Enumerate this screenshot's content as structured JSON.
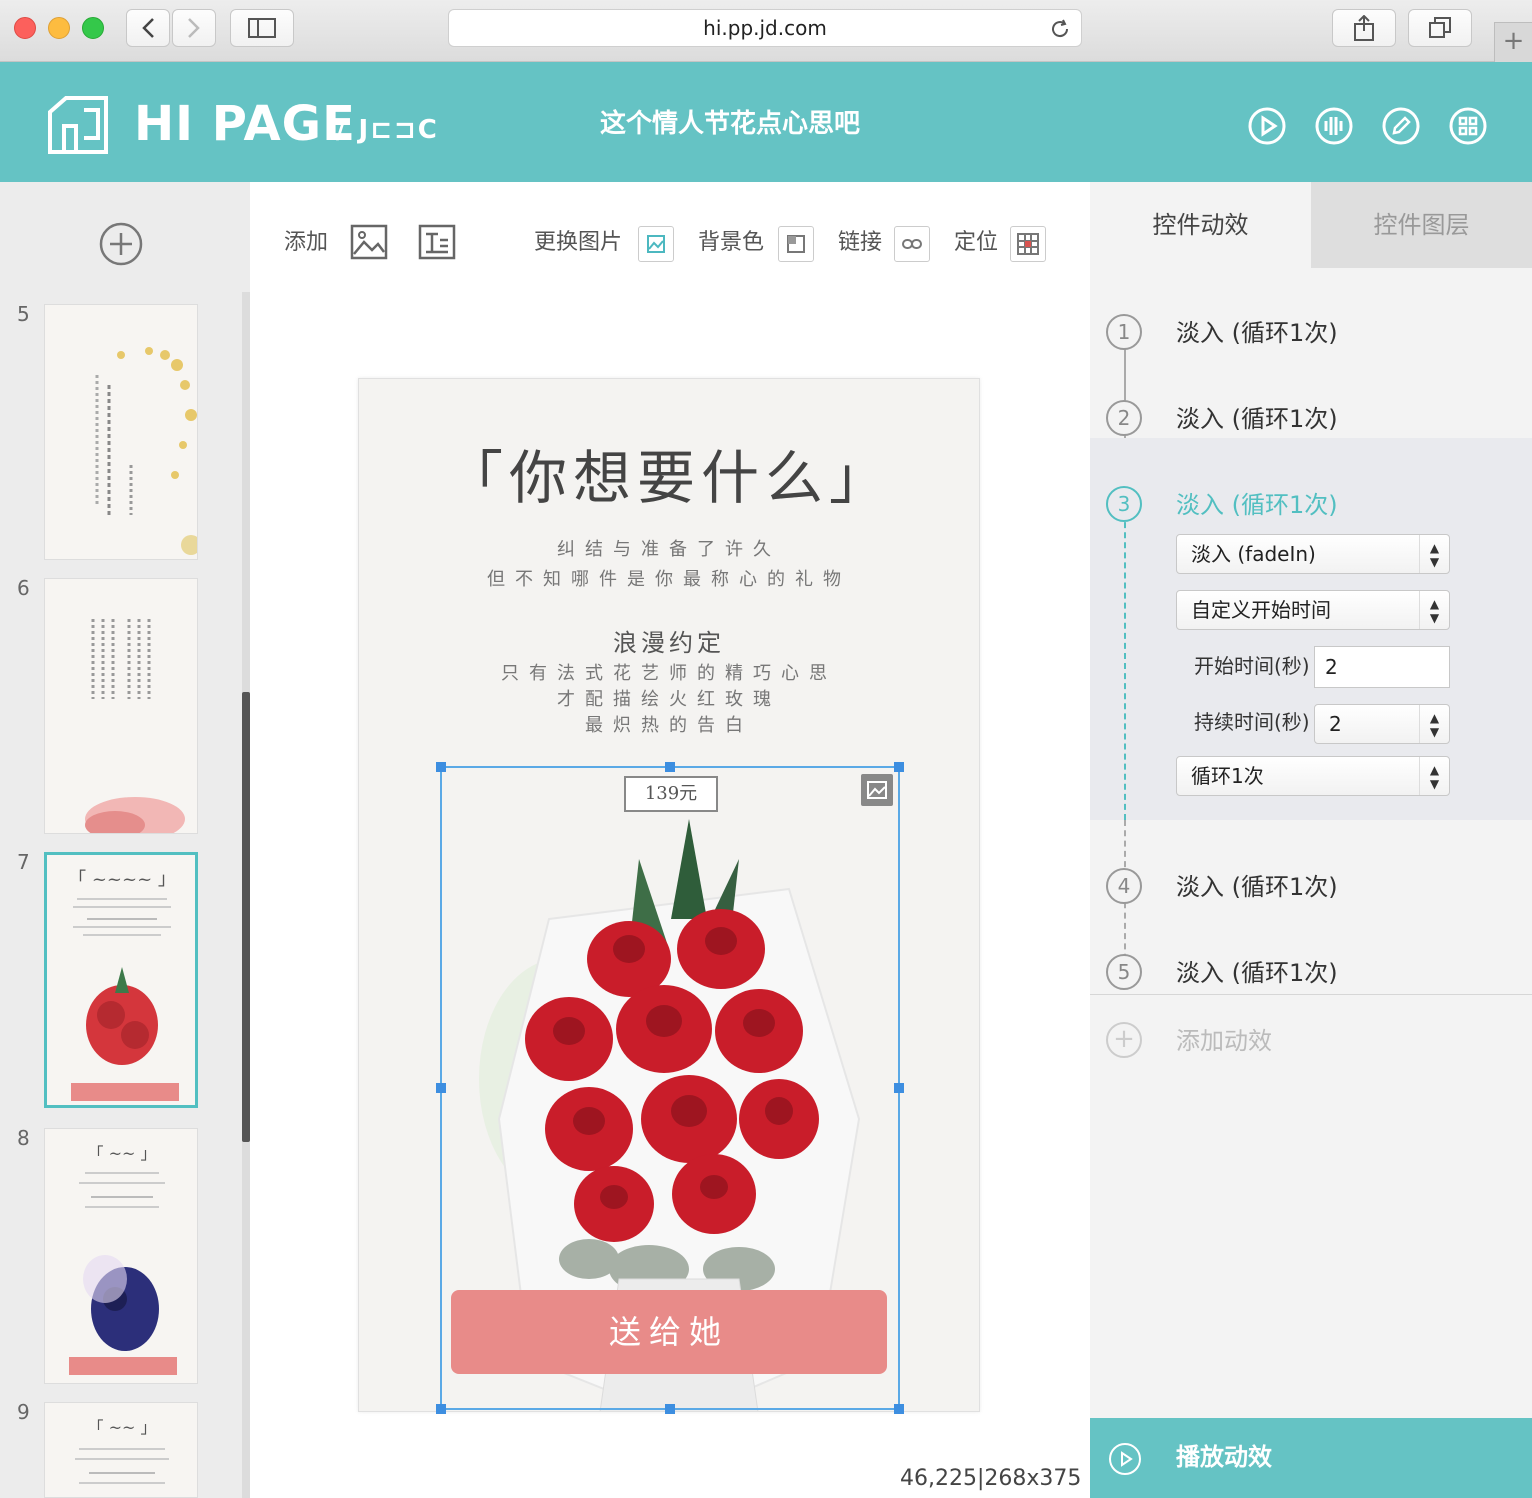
{
  "browser": {
    "url": "hi.pp.jd.com"
  },
  "header": {
    "logo_text": "HI PAGE",
    "logo_sub": "/ J⊏⊐C",
    "page_title": "这个情人节花点心思吧",
    "icons": [
      "play-icon",
      "audio-icon",
      "edit-icon",
      "grid-icon"
    ],
    "accent_color": "#65c3c4"
  },
  "sidebar": {
    "pages": [
      {
        "num": "5"
      },
      {
        "num": "6"
      },
      {
        "num": "7",
        "active": true
      },
      {
        "num": "8"
      },
      {
        "num": "9"
      }
    ]
  },
  "toolbar": {
    "add_label": "添加",
    "replace_image_label": "更换图片",
    "bg_color_label": "背景色",
    "link_label": "链接",
    "position_label": "定位"
  },
  "canvas": {
    "title": "「你想要什么」",
    "line1": "纠结与准备了许久",
    "line2": "但不知哪件是你最称心的礼物",
    "subtitle": "浪漫约定",
    "line3": "只有法式花艺师的精巧心思",
    "line4": "才配描绘火红玫瑰",
    "line5": "最炽热的告白",
    "price": "139元",
    "button_label": "送给她",
    "button_color": "#e88b89",
    "coords_text": "46,225|268x375"
  },
  "panel": {
    "tab_effects": "控件动效",
    "tab_layers": "控件图层",
    "animations": [
      {
        "num": "1",
        "label": "淡入 (循环1次)"
      },
      {
        "num": "2",
        "label": "淡入 (循环1次)"
      },
      {
        "num": "3",
        "label": "淡入 (循环1次)"
      },
      {
        "num": "4",
        "label": "淡入 (循环1次)"
      },
      {
        "num": "5",
        "label": "淡入 (循环1次)"
      }
    ],
    "effect_select": "淡入 (fadeIn)",
    "start_mode_select": "自定义开始时间",
    "start_time_label": "开始时间(秒)",
    "start_time_value": "2",
    "duration_label": "持续时间(秒)",
    "duration_value": "2",
    "loop_select": "循环1次",
    "add_anim_label": "添加动效",
    "play_label": "播放动效"
  }
}
